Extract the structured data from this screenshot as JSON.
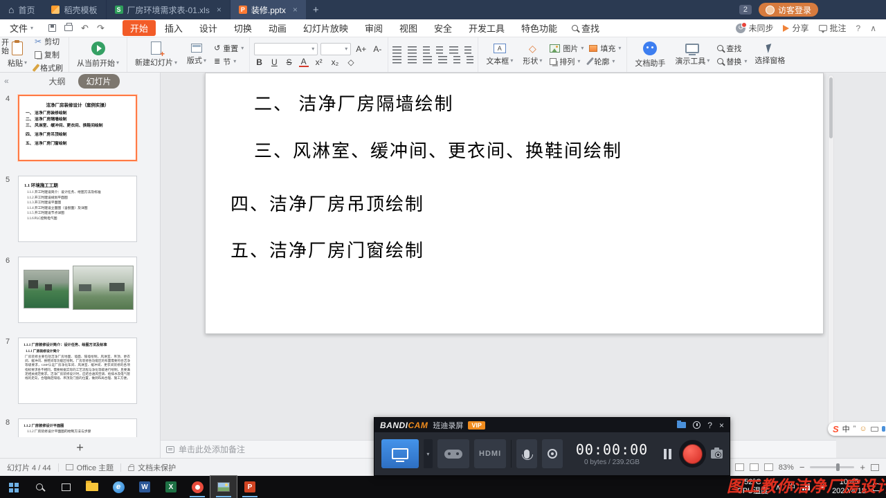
{
  "icons": {
    "home": "⌂",
    "caret": "▾",
    "close": "×",
    "plus": "+",
    "undo": "↶",
    "redo": "↷",
    "reset_glyph": "↺",
    "help": "?",
    "collapse": "∧",
    "back": "«",
    "scissor": "✂",
    "diamond": "◇",
    "superscript": "x²",
    "subscript": "x₂",
    "a_plus": "A+",
    "a_minus": "A-",
    "section_glyph": "≣",
    "xls_letter": "S",
    "ppt_letter": "P",
    "browser_letter": "e",
    "word_letter": "W",
    "excel_letter": "X",
    "ppt_app_letter": "P"
  },
  "titlebar": {
    "home": "首页",
    "docer": "稻壳模板",
    "tab_xls": "厂房环境需求表-01.xls",
    "tab_ppt": "装修.pptx",
    "badge": "2",
    "login": "访客登录"
  },
  "menubar": {
    "file": "文件",
    "start_vertical": "开始",
    "tabs": [
      {
        "label": "开始",
        "active": true
      },
      {
        "label": "插入"
      },
      {
        "label": "设计"
      },
      {
        "label": "切换"
      },
      {
        "label": "动画"
      },
      {
        "label": "幻灯片放映"
      },
      {
        "label": "审阅"
      },
      {
        "label": "视图"
      },
      {
        "label": "安全"
      },
      {
        "label": "开发工具"
      },
      {
        "label": "特色功能"
      }
    ],
    "find": "查找",
    "sync": "未同步",
    "share": "分享",
    "comment": "批注"
  },
  "ribbon": {
    "paste": "粘贴",
    "cut": "剪切",
    "copy": "复制",
    "format_painter": "格式刷",
    "from_current": "从当前开始",
    "new_slide": "新建幻灯片",
    "layout": "版式",
    "reset": "重置",
    "section": "节",
    "bold": "B",
    "underline": "U",
    "strike": "S",
    "font_color": "A",
    "textbox": "文本框",
    "shapes": "形状",
    "picture": "图片",
    "fill": "填充",
    "arrange": "排列",
    "outline": "轮廓",
    "doc_assistant": "文档助手",
    "present_tools": "演示工具",
    "find": "查找",
    "replace": "替换",
    "select_pane": "选择窗格"
  },
  "sidebar": {
    "tab_outline": "大纲",
    "tab_slides": "幻灯片",
    "slides": [
      {
        "num": "4",
        "title": "洁净厂房装修设计（案例实操）",
        "lines": [
          "一、 洁净厂房装修绘制",
          "二、 洁净厂房隔墙绘制",
          "三、 风淋室、缓冲间、更衣间、换鞋间绘制",
          "四、 洁净厂房吊顶绘制",
          "五、 洁净厂房门窗绘制"
        ]
      },
      {
        "num": "5",
        "title": "1.1 环境施工工期",
        "lines": [
          "1.1.1  开工时建设简介：设计任务、绘图方法及标准",
          "1.1.2  开工时建设规划平面图",
          "1.1.3  开工时建设平面图",
          "1.1.4  开工时建设立面图（含剖面）及详图",
          "1.1.5  开工时建设节点详图",
          "1.1.6  PLC控制电气图"
        ]
      },
      {
        "num": "6"
      },
      {
        "num": "7",
        "title": "1.1.1  厂房装修设计简介：设计任务、绘图方法及标准",
        "subtitle": "1.1.1  厂房装修设计简介",
        "body": "厂房装修主要包括洁净厂房地面、墙面、隔墙绘制，风淋室、吊顶、更衣间、缓冲间、换鞋间等功能区绘制。厂房装修各功能区的布置需要符合洁净等级要求，GMP认证厂房净化车间、风淋室、缓冲间、更衣间装修的各项指标要求各不相同，需要根据实际的工艺流程与净化等级进行绘制，且要满足相关规范要求。洁净厂房装修设计时，应结合通风空调、给排水及电气管线的走向，合理确定隔墙、吊顶及门窗的位置，做到布局合理、施工方便。"
      },
      {
        "num": "8",
        "title": "1.1.2  厂房装修设计平面图",
        "lines": [
          "1.1.2  厂房装修设计平面图的绘制方法与步骤"
        ]
      }
    ],
    "add": "+"
  },
  "slide": {
    "items": [
      "二、 洁净厂房隔墙绘制",
      "三、风淋室、缓冲间、更衣间、换鞋间绘制",
      "四、洁净厂房吊顶绘制",
      "五、洁净厂房门窗绘制"
    ]
  },
  "notes": {
    "placeholder": "单击此处添加备注"
  },
  "statusbar": {
    "counter": "幻灯片 4 / 44",
    "theme": "Office 主题",
    "protection": "文档未保护",
    "zoom": "83%"
  },
  "bandicam": {
    "brand_a": "BANDI",
    "brand_b": "CAM",
    "name": "班迪录屏",
    "vip": "VIP",
    "hdmi": "HDMI",
    "timer": "00:00:00",
    "size": "0 bytes / 239.2GB"
  },
  "taskbar": {
    "temp": "52°C",
    "temp_label": "CPU温度",
    "time": "10:45",
    "date": "2020/4/18"
  },
  "sogou": {
    "logo": "S",
    "lang": "中",
    "punct": "”",
    "emoji": "☺"
  },
  "watermark": {
    "text": "图工教你洁净厂房设计"
  }
}
